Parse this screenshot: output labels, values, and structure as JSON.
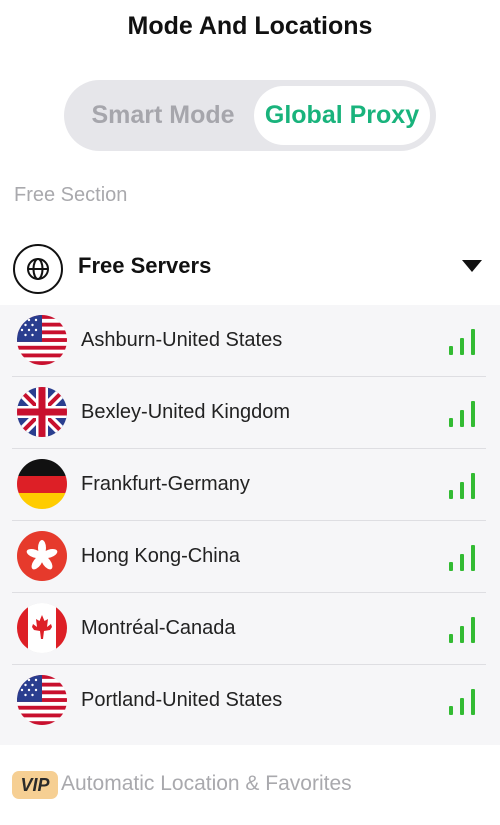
{
  "page": {
    "title": "Mode And Locations"
  },
  "mode_toggle": {
    "options": [
      "Smart Mode",
      "Global Proxy"
    ],
    "selected": "Global Proxy",
    "selected_color": "#19b37c"
  },
  "free_section": {
    "label": "Free Section",
    "header": {
      "title": "Free Servers",
      "icon": "globe-icon",
      "expand_icon": "caret-down-icon"
    },
    "servers": [
      {
        "name": "Ashburn-United States",
        "flag": "us-flag-icon",
        "signal": "full"
      },
      {
        "name": "Bexley-United Kingdom",
        "flag": "uk-flag-icon",
        "signal": "full"
      },
      {
        "name": "Frankfurt-Germany",
        "flag": "germany-flag-icon",
        "signal": "full"
      },
      {
        "name": "Hong Kong-China",
        "flag": "hong-kong-flag-icon",
        "signal": "full"
      },
      {
        "name": "Montréal-Canada",
        "flag": "canada-flag-icon",
        "signal": "full"
      },
      {
        "name": "Portland-United States",
        "flag": "us-flag-icon",
        "signal": "full"
      }
    ],
    "signal_color": "#33bb33"
  },
  "vip_section": {
    "badge": "VIP",
    "label": "Automatic Location & Favorites",
    "badge_color": "#f6cf93"
  }
}
